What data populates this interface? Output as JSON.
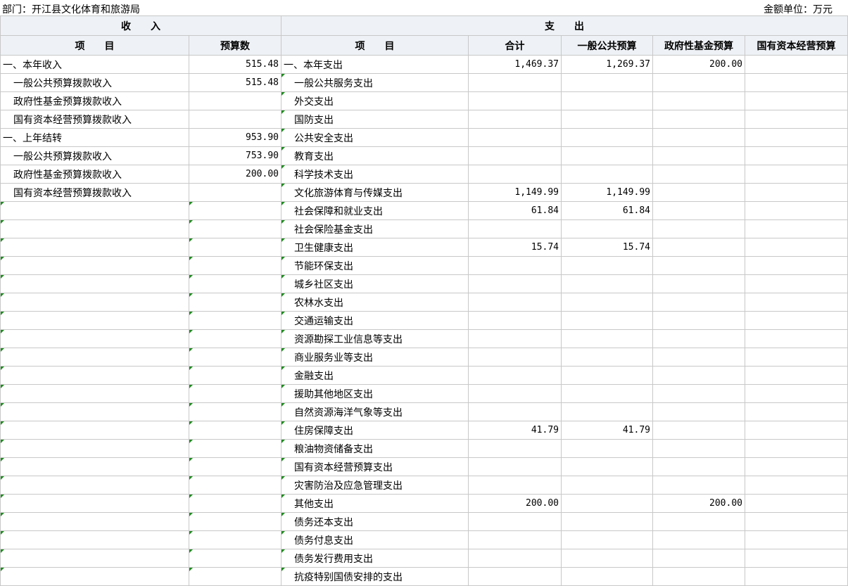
{
  "header": {
    "department": "部门：开江县文化体育和旅游局",
    "unit": "金额单位：万元"
  },
  "columns": {
    "income_group": "收　　入",
    "expense_group": "支　　出",
    "income_item": "项　　目",
    "income_budget": "预算数",
    "expense_item": "项　　目",
    "total": "合计",
    "general": "一般公共预算",
    "fund": "政府性基金预算",
    "state": "国有资本经营预算"
  },
  "rows": [
    {
      "in_item": "一、本年收入",
      "in_indent": false,
      "in_amount": "515.48",
      "ex_item": "一、本年支出",
      "ex_indent": false,
      "total": "1,469.37",
      "general": "1,269.37",
      "fund": "200.00",
      "state": ""
    },
    {
      "in_item": "一般公共预算拨款收入",
      "in_indent": true,
      "in_amount": "515.48",
      "ex_item": "一般公共服务支出",
      "ex_indent": true,
      "total": "",
      "general": "",
      "fund": "",
      "state": ""
    },
    {
      "in_item": "政府性基金预算拨款收入",
      "in_indent": true,
      "in_amount": "",
      "ex_item": "外交支出",
      "ex_indent": true,
      "total": "",
      "general": "",
      "fund": "",
      "state": ""
    },
    {
      "in_item": "国有资本经营预算拨款收入",
      "in_indent": true,
      "in_amount": "",
      "ex_item": "国防支出",
      "ex_indent": true,
      "total": "",
      "general": "",
      "fund": "",
      "state": ""
    },
    {
      "in_item": "一、上年结转",
      "in_indent": false,
      "in_amount": "953.90",
      "ex_item": "公共安全支出",
      "ex_indent": true,
      "total": "",
      "general": "",
      "fund": "",
      "state": ""
    },
    {
      "in_item": "一般公共预算拨款收入",
      "in_indent": true,
      "in_amount": "753.90",
      "ex_item": "教育支出",
      "ex_indent": true,
      "total": "",
      "general": "",
      "fund": "",
      "state": ""
    },
    {
      "in_item": "政府性基金预算拨款收入",
      "in_indent": true,
      "in_amount": "200.00",
      "ex_item": "科学技术支出",
      "ex_indent": true,
      "total": "",
      "general": "",
      "fund": "",
      "state": ""
    },
    {
      "in_item": "国有资本经营预算拨款收入",
      "in_indent": true,
      "in_amount": "",
      "ex_item": "文化旅游体育与传媒支出",
      "ex_indent": true,
      "total": "1,149.99",
      "general": "1,149.99",
      "fund": "",
      "state": ""
    },
    {
      "in_item": "",
      "in_indent": false,
      "in_amount": "",
      "ex_item": "社会保障和就业支出",
      "ex_indent": true,
      "total": "61.84",
      "general": "61.84",
      "fund": "",
      "state": ""
    },
    {
      "in_item": "",
      "in_indent": false,
      "in_amount": "",
      "ex_item": "社会保险基金支出",
      "ex_indent": true,
      "total": "",
      "general": "",
      "fund": "",
      "state": ""
    },
    {
      "in_item": "",
      "in_indent": false,
      "in_amount": "",
      "ex_item": "卫生健康支出",
      "ex_indent": true,
      "total": "15.74",
      "general": "15.74",
      "fund": "",
      "state": ""
    },
    {
      "in_item": "",
      "in_indent": false,
      "in_amount": "",
      "ex_item": "节能环保支出",
      "ex_indent": true,
      "total": "",
      "general": "",
      "fund": "",
      "state": ""
    },
    {
      "in_item": "",
      "in_indent": false,
      "in_amount": "",
      "ex_item": "城乡社区支出",
      "ex_indent": true,
      "total": "",
      "general": "",
      "fund": "",
      "state": ""
    },
    {
      "in_item": "",
      "in_indent": false,
      "in_amount": "",
      "ex_item": "农林水支出",
      "ex_indent": true,
      "total": "",
      "general": "",
      "fund": "",
      "state": ""
    },
    {
      "in_item": "",
      "in_indent": false,
      "in_amount": "",
      "ex_item": "交通运输支出",
      "ex_indent": true,
      "total": "",
      "general": "",
      "fund": "",
      "state": ""
    },
    {
      "in_item": "",
      "in_indent": false,
      "in_amount": "",
      "ex_item": "资源勘探工业信息等支出",
      "ex_indent": true,
      "total": "",
      "general": "",
      "fund": "",
      "state": ""
    },
    {
      "in_item": "",
      "in_indent": false,
      "in_amount": "",
      "ex_item": "商业服务业等支出",
      "ex_indent": true,
      "total": "",
      "general": "",
      "fund": "",
      "state": ""
    },
    {
      "in_item": "",
      "in_indent": false,
      "in_amount": "",
      "ex_item": "金融支出",
      "ex_indent": true,
      "total": "",
      "general": "",
      "fund": "",
      "state": ""
    },
    {
      "in_item": "",
      "in_indent": false,
      "in_amount": "",
      "ex_item": "援助其他地区支出",
      "ex_indent": true,
      "total": "",
      "general": "",
      "fund": "",
      "state": ""
    },
    {
      "in_item": "",
      "in_indent": false,
      "in_amount": "",
      "ex_item": "自然资源海洋气象等支出",
      "ex_indent": true,
      "total": "",
      "general": "",
      "fund": "",
      "state": ""
    },
    {
      "in_item": "",
      "in_indent": false,
      "in_amount": "",
      "ex_item": "住房保障支出",
      "ex_indent": true,
      "total": "41.79",
      "general": "41.79",
      "fund": "",
      "state": ""
    },
    {
      "in_item": "",
      "in_indent": false,
      "in_amount": "",
      "ex_item": "粮油物资储备支出",
      "ex_indent": true,
      "total": "",
      "general": "",
      "fund": "",
      "state": ""
    },
    {
      "in_item": "",
      "in_indent": false,
      "in_amount": "",
      "ex_item": "国有资本经营预算支出",
      "ex_indent": true,
      "total": "",
      "general": "",
      "fund": "",
      "state": ""
    },
    {
      "in_item": "",
      "in_indent": false,
      "in_amount": "",
      "ex_item": "灾害防治及应急管理支出",
      "ex_indent": true,
      "total": "",
      "general": "",
      "fund": "",
      "state": ""
    },
    {
      "in_item": "",
      "in_indent": false,
      "in_amount": "",
      "ex_item": "其他支出",
      "ex_indent": true,
      "total": "200.00",
      "general": "",
      "fund": "200.00",
      "state": ""
    },
    {
      "in_item": "",
      "in_indent": false,
      "in_amount": "",
      "ex_item": "债务还本支出",
      "ex_indent": true,
      "total": "",
      "general": "",
      "fund": "",
      "state": ""
    },
    {
      "in_item": "",
      "in_indent": false,
      "in_amount": "",
      "ex_item": "债务付息支出",
      "ex_indent": true,
      "total": "",
      "general": "",
      "fund": "",
      "state": ""
    },
    {
      "in_item": "",
      "in_indent": false,
      "in_amount": "",
      "ex_item": "债务发行费用支出",
      "ex_indent": true,
      "total": "",
      "general": "",
      "fund": "",
      "state": ""
    },
    {
      "in_item": "",
      "in_indent": false,
      "in_amount": "",
      "ex_item": "抗疫特别国债安排的支出",
      "ex_indent": true,
      "total": "",
      "general": "",
      "fund": "",
      "state": ""
    }
  ]
}
